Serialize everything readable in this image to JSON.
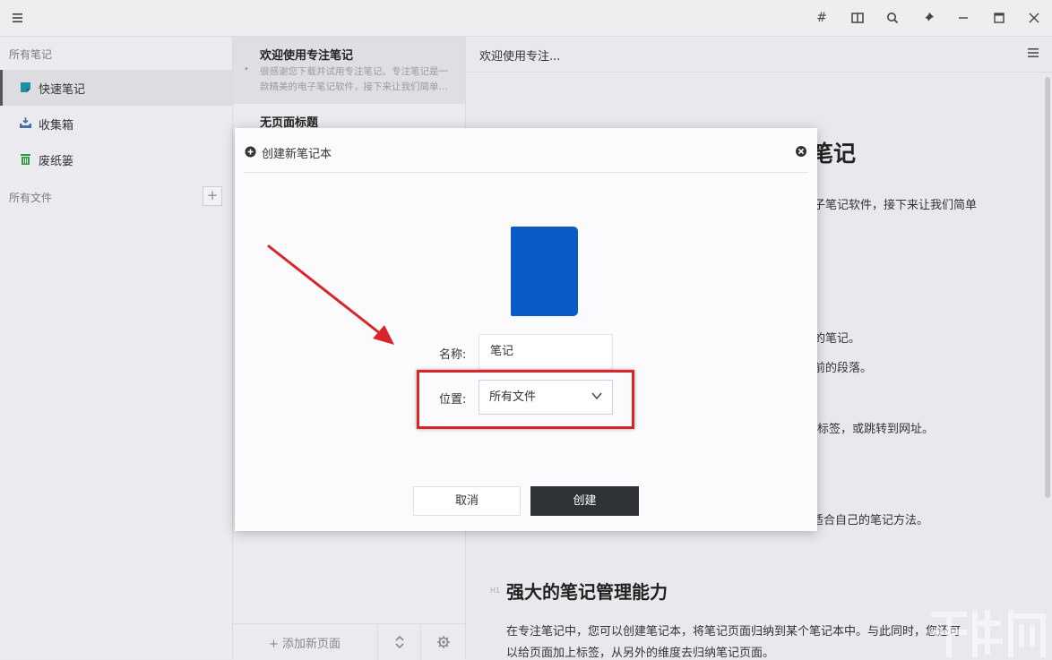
{
  "sidebar": {
    "section_all_notes": "所有笔记",
    "items": [
      {
        "label": "快速笔记",
        "icon": "quick-note-icon"
      },
      {
        "label": "收集箱",
        "icon": "inbox-icon"
      },
      {
        "label": "废纸篓",
        "icon": "trash-icon"
      }
    ],
    "section_all_files": "所有文件",
    "add_label": "+"
  },
  "note_list": {
    "notes": [
      {
        "title": "欢迎使用专注笔记",
        "excerpt_line1": "很感谢您下载并试用专注笔记。专注笔记是一",
        "excerpt_line2": "款精美的电子笔记软件，接下来让我们简单…"
      },
      {
        "title": "无页面标题"
      }
    ],
    "footer": {
      "add_page": "+ 添加新页面"
    }
  },
  "editor": {
    "header_title": "欢迎使用专注...",
    "fragments": [
      {
        "text": "笔记"
      },
      {
        "text": "子笔记软件，接下来让我们简单"
      },
      {
        "text": "的笔记。"
      },
      {
        "text": "前的段落。"
      },
      {
        "text": "标签，或跳转到网址。"
      },
      {
        "text": "适合自己的笔记方法。"
      }
    ],
    "h1_badge": "H1",
    "heading": "强大的笔记管理能力",
    "para_line1": "在专注笔记中，您可以创建笔记本，将笔记页面归纳到某个笔记本中。与此同时，您还可",
    "para_line2": "以给页面加上标签，从另外的维度去归纳笔记页面。"
  },
  "modal": {
    "title": "创建新笔记本",
    "cover_color": "#0a5bc8",
    "name_label": "名称:",
    "name_value": "笔记",
    "location_label": "位置:",
    "location_value": "所有文件",
    "cancel_label": "取消",
    "create_label": "创建"
  },
  "colors": {
    "accent_dark": "#2f3236",
    "annotation_red": "#d9252a"
  }
}
